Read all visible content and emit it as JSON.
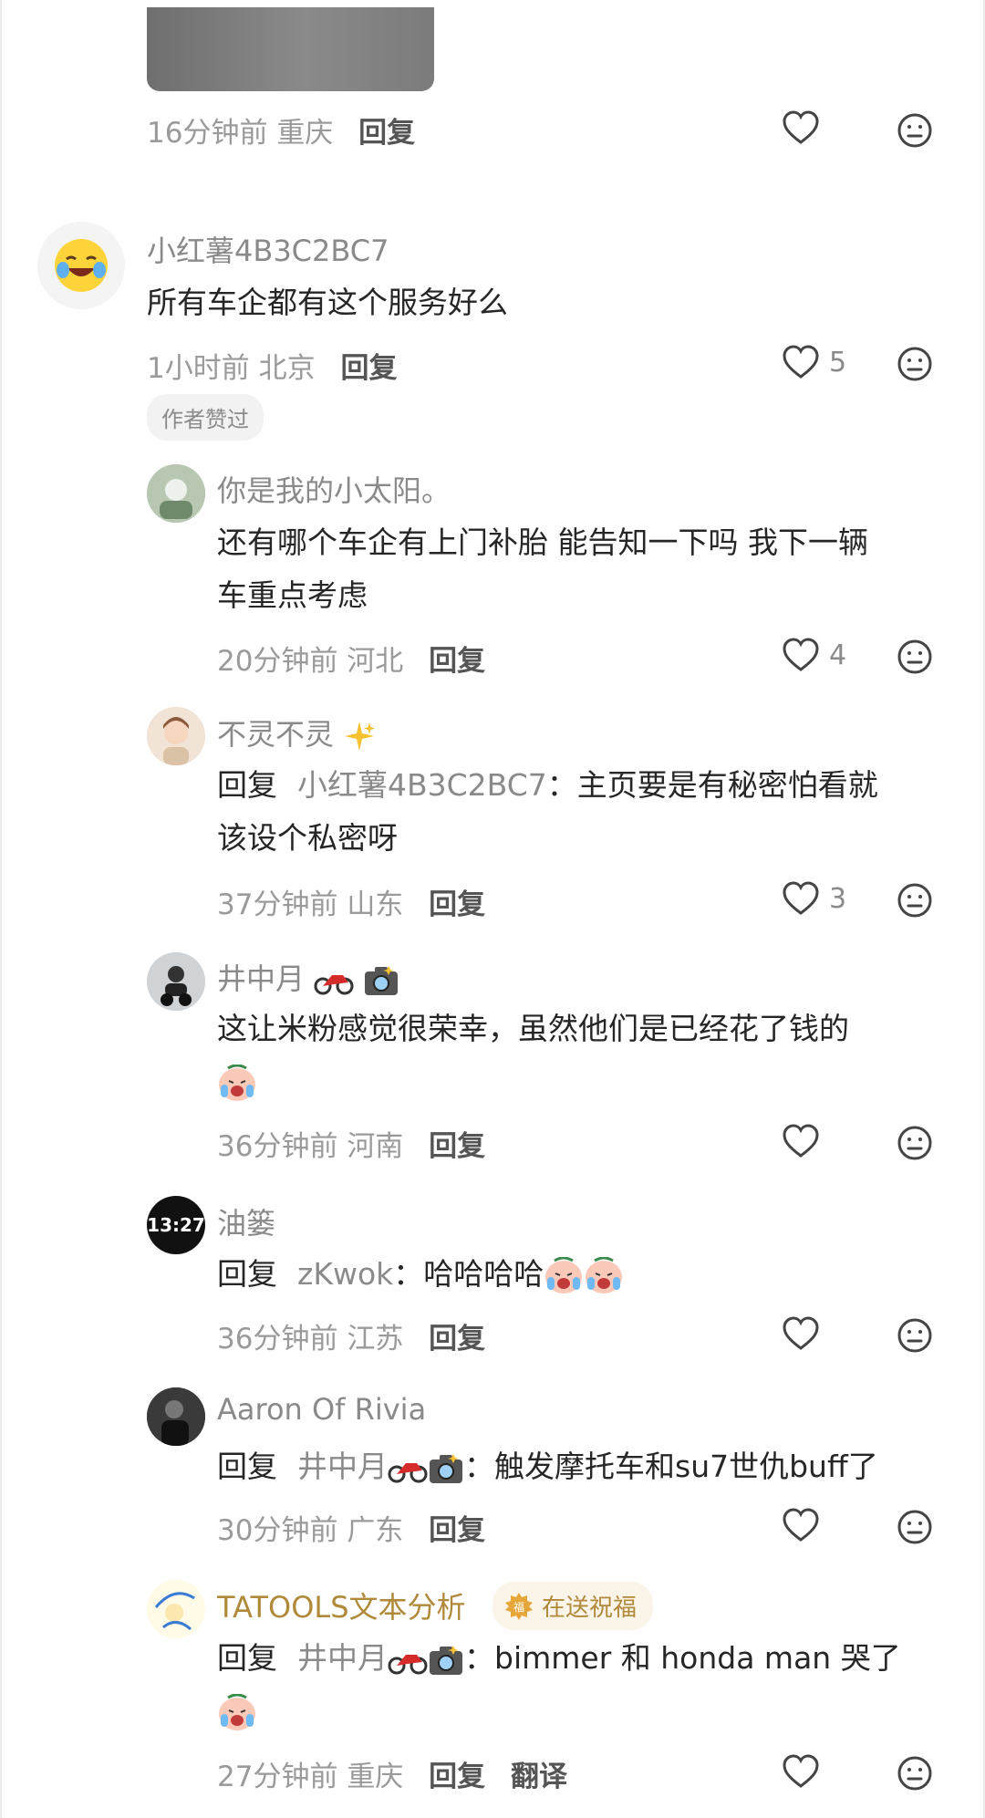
{
  "comments": [
    {
      "time": "16分钟前",
      "location": "重庆",
      "reply_label": "回复"
    },
    {
      "username": "小红薯4B3C2BC7",
      "text": "所有车企都有这个服务好么",
      "time": "1小时前",
      "location": "北京",
      "reply_label": "回复",
      "likes": "5",
      "tag": "作者赞过",
      "avatar_icon": "laughing-emoji-avatar"
    }
  ],
  "replies": [
    {
      "username": "你是我的小太阳。",
      "text_line1": "还有哪个车企有上门补胎 能告知一下吗 我下一辆",
      "text_line2": "车重点考虑",
      "time": "20分钟前",
      "location": "河北",
      "reply_label": "回复",
      "likes": "4"
    },
    {
      "username": "不灵不灵",
      "name_emoji": "sparkles-emoji",
      "reply_prefix": "回复",
      "mention": "小红薯4B3C2BC7",
      "text_line1": "：主页要是有秘密怕看就",
      "text_line2": "该设个私密呀",
      "time": "37分钟前",
      "location": "山东",
      "reply_label": "回复",
      "likes": "3"
    },
    {
      "username": "井中月",
      "name_emoji": "motorcycle-camera-emoji",
      "text_line1": "这让米粉感觉很荣幸，虽然他们是已经花了钱的",
      "text_emoji": "crying-laugh-emoji",
      "time": "36分钟前",
      "location": "河南",
      "reply_label": "回复"
    },
    {
      "username": "油篓",
      "avatar_text": "13:27",
      "reply_prefix": "回复",
      "mention": "zKwok",
      "text_line1": "：哈哈哈哈",
      "text_emoji": "crying-laugh-emoji",
      "time": "36分钟前",
      "location": "江苏",
      "reply_label": "回复"
    },
    {
      "username": "Aaron Of Rivia",
      "reply_prefix": "回复",
      "mention": "井中月",
      "text_line1": "：触发摩托车和su7世仇buff了",
      "time": "30分钟前",
      "location": "广东",
      "reply_label": "回复"
    },
    {
      "username": "TATOOLS文本分析",
      "badge": "在送祝福",
      "reply_prefix": "回复",
      "mention": "井中月",
      "text_line1": "：bimmer 和 honda man 哭了",
      "text_emoji": "crying-laugh-emoji",
      "time": "27分钟前",
      "location": "重庆",
      "reply_label": "回复",
      "translate_label": "翻译"
    }
  ],
  "colors": {
    "accent_gold": "#b08a3a",
    "meta_gray": "#9a9a9a",
    "text_dark": "#262626"
  }
}
